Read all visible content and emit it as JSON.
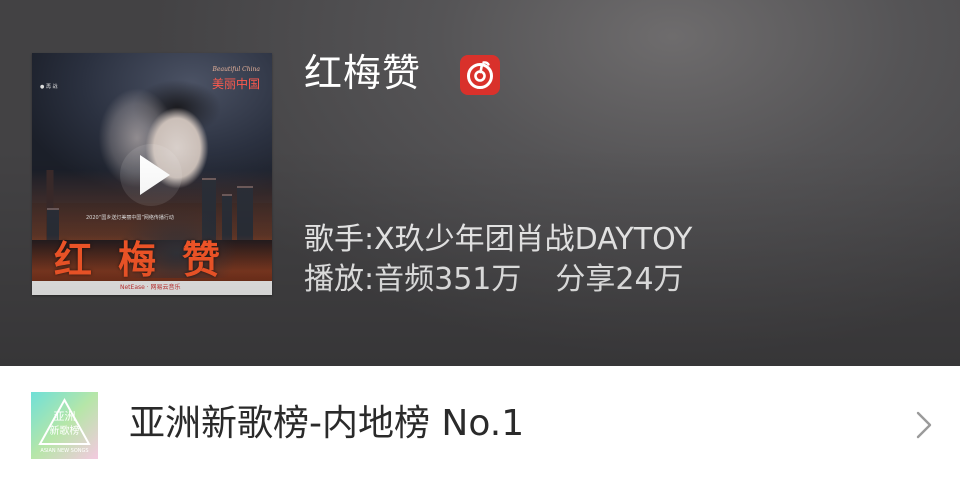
{
  "song": {
    "title": "红梅赞",
    "singer_line": "歌手:X玖少年团肖战DAYTOY",
    "play_line_prefix": "播放:音频351万",
    "share_line": "分享24万"
  },
  "cover": {
    "brand_text": "美丽中国",
    "calligraphy_text": "红梅赞",
    "note_text": "2020“国乡送灯美丽中国”网络传播行动",
    "bottom_text": "NetEase · 网易云音乐"
  },
  "rank": {
    "label": "亚洲新歌榜-内地榜 No.1"
  },
  "icons": {
    "play": "play-icon",
    "source": "netease-music-icon",
    "chart_logo": "asian-new-songs-chart-logo",
    "chevron": "chevron-right-icon"
  },
  "colors": {
    "netease_red": "#d9312b",
    "hero_gray": "#555456",
    "cover_accent": "#ff5a2a"
  }
}
